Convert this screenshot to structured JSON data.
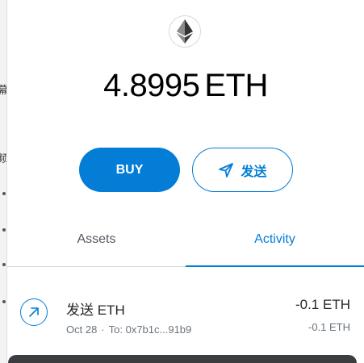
{
  "balance": {
    "amount": "4.8995",
    "unit": "ETH"
  },
  "token_icon": "ethereum-icon",
  "actions": {
    "buy_label": "BUY",
    "send_label": "发送",
    "send_icon": "send-arrow-icon"
  },
  "tabs": [
    {
      "label": "Assets",
      "active": false
    },
    {
      "label": "Activity",
      "active": true
    }
  ],
  "activity": [
    {
      "title": "发送 ETH",
      "date": "Oct 28",
      "separator": "·",
      "to": "To: 0x7b1c...91b9",
      "amount": "-0.1 ETH",
      "secondary_amount": "-0.1 ETH",
      "icon": "outgoing-arrow-icon"
    }
  ],
  "background_fragments": [
    "幕",
    "频"
  ],
  "colors": {
    "accent": "#037dd6",
    "text": "#24272a",
    "muted": "#6a737d",
    "divider": "#d6d9dc"
  }
}
